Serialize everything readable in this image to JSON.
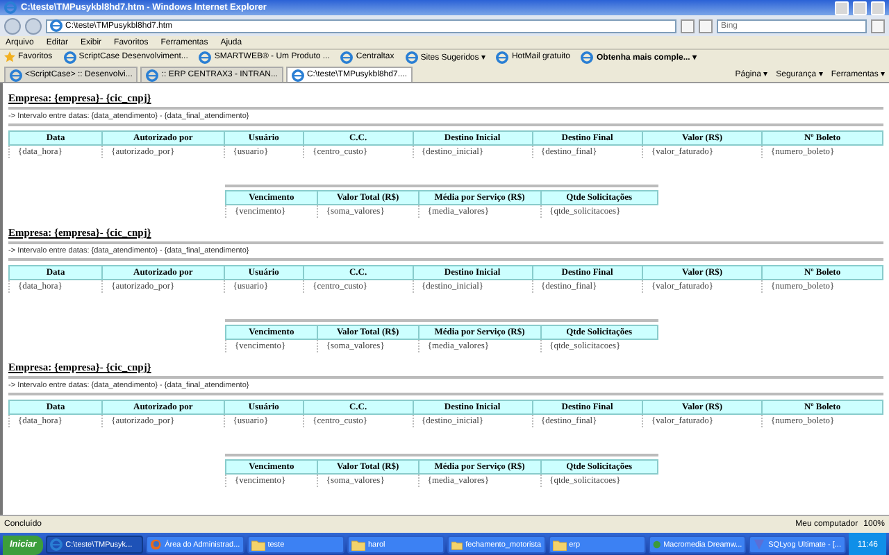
{
  "window": {
    "title": "C:\\teste\\TMPusykbl8hd7.htm - Windows Internet Explorer"
  },
  "address": {
    "value": "C:\\teste\\TMPusykbl8hd7.htm"
  },
  "search": {
    "placeholder": "Bing"
  },
  "menu": [
    "Arquivo",
    "Editar",
    "Exibir",
    "Favoritos",
    "Ferramentas",
    "Ajuda"
  ],
  "favorites": {
    "label": "Favoritos",
    "links": [
      {
        "label": "ScriptCase  Desenvolviment...",
        "bold": false
      },
      {
        "label": "SMARTWEB® - Um Produto ...",
        "bold": false
      },
      {
        "label": "Centraltax",
        "bold": false
      },
      {
        "label": "Sites Sugeridos ▾",
        "bold": false
      },
      {
        "label": "HotMail gratuito",
        "bold": false
      },
      {
        "label": "Obtenha mais comple... ▾",
        "bold": true
      }
    ]
  },
  "tabs": [
    {
      "label": "<ScriptCase> :: Desenvolvi...",
      "selected": false
    },
    {
      "label": ":: ERP CENTRAX3 - INTRAN...",
      "selected": false
    },
    {
      "label": "C:\\teste\\TMPusykbl8hd7....",
      "selected": true
    }
  ],
  "commands": [
    "Página ▾",
    "Segurança ▾",
    "Ferramentas ▾"
  ],
  "sections": [
    {
      "heading": "Empresa: {empresa}- {cic_cnpj}",
      "interval": "-> Intervalo entre datas: {data_atendimento} - {data_final_atendimento}",
      "columns": [
        "Data",
        "Autorizado por",
        "Usuário",
        "C.C.",
        "Destino Inicial",
        "Destino Final",
        "Valor (R$)",
        "Nº Boleto"
      ],
      "row": [
        "{data_hora}",
        "{autorizado_por}",
        "{usuario}",
        "{centro_custo}",
        "{destino_inicial}",
        "{destino_final}",
        "{valor_faturado}",
        "{numero_boleto}"
      ],
      "summary_columns": [
        "Vencimento",
        "Valor Total (R$)",
        "Média por Serviço (R$)",
        "Qtde Solicitações"
      ],
      "summary_row": [
        "{vencimento}",
        "{soma_valores}",
        "{media_valores}",
        "{qtde_solicitacoes}"
      ]
    },
    {
      "heading": "Empresa: {empresa}- {cic_cnpj}",
      "interval": "-> Intervalo entre datas: {data_atendimento} - {data_final_atendimento}",
      "columns": [
        "Data",
        "Autorizado por",
        "Usuário",
        "C.C.",
        "Destino Inicial",
        "Destino Final",
        "Valor (R$)",
        "Nº Boleto"
      ],
      "row": [
        "{data_hora}",
        "{autorizado_por}",
        "{usuario}",
        "{centro_custo}",
        "{destino_inicial}",
        "{destino_final}",
        "{valor_faturado}",
        "{numero_boleto}"
      ],
      "summary_columns": [
        "Vencimento",
        "Valor Total (R$)",
        "Média por Serviço (R$)",
        "Qtde Solicitações"
      ],
      "summary_row": [
        "{vencimento}",
        "{soma_valores}",
        "{media_valores}",
        "{qtde_solicitacoes}"
      ]
    },
    {
      "heading": "Empresa: {empresa}- {cic_cnpj}",
      "interval": "-> Intervalo entre datas: {data_atendimento} - {data_final_atendimento}",
      "columns": [
        "Data",
        "Autorizado por",
        "Usuário",
        "C.C.",
        "Destino Inicial",
        "Destino Final",
        "Valor (R$)",
        "Nº Boleto"
      ],
      "row": [
        "{data_hora}",
        "{autorizado_por}",
        "{usuario}",
        "{centro_custo}",
        "{destino_inicial}",
        "{destino_final}",
        "{valor_faturado}",
        "{numero_boleto}"
      ],
      "summary_columns": [
        "Vencimento",
        "Valor Total (R$)",
        "Média por Serviço (R$)",
        "Qtde Solicitações"
      ],
      "summary_row": [
        "{vencimento}",
        "{soma_valores}",
        "{media_valores}",
        "{qtde_solicitacoes}"
      ]
    }
  ],
  "status_bar": {
    "text": "Concluído",
    "zone": "Meu computador",
    "zoom": "100%"
  },
  "taskbar": {
    "start": "Iniciar",
    "items": [
      {
        "label": "C:\\teste\\TMPusyk...",
        "kind": "ie",
        "selected": true
      },
      {
        "label": "Área do Administrad...",
        "kind": "firefox",
        "selected": false
      },
      {
        "label": "teste",
        "kind": "folder",
        "selected": false
      },
      {
        "label": "harol",
        "kind": "folder",
        "selected": false
      },
      {
        "label": "fechamento_motorista",
        "kind": "folder",
        "selected": false
      },
      {
        "label": "erp",
        "kind": "folder",
        "selected": false
      },
      {
        "label": "Macromedia Dreamw...",
        "kind": "dreamweaver",
        "selected": false
      },
      {
        "label": "SQLyog Ultimate - [...",
        "kind": "sqlyog",
        "selected": false
      }
    ],
    "clock": "11:46"
  }
}
